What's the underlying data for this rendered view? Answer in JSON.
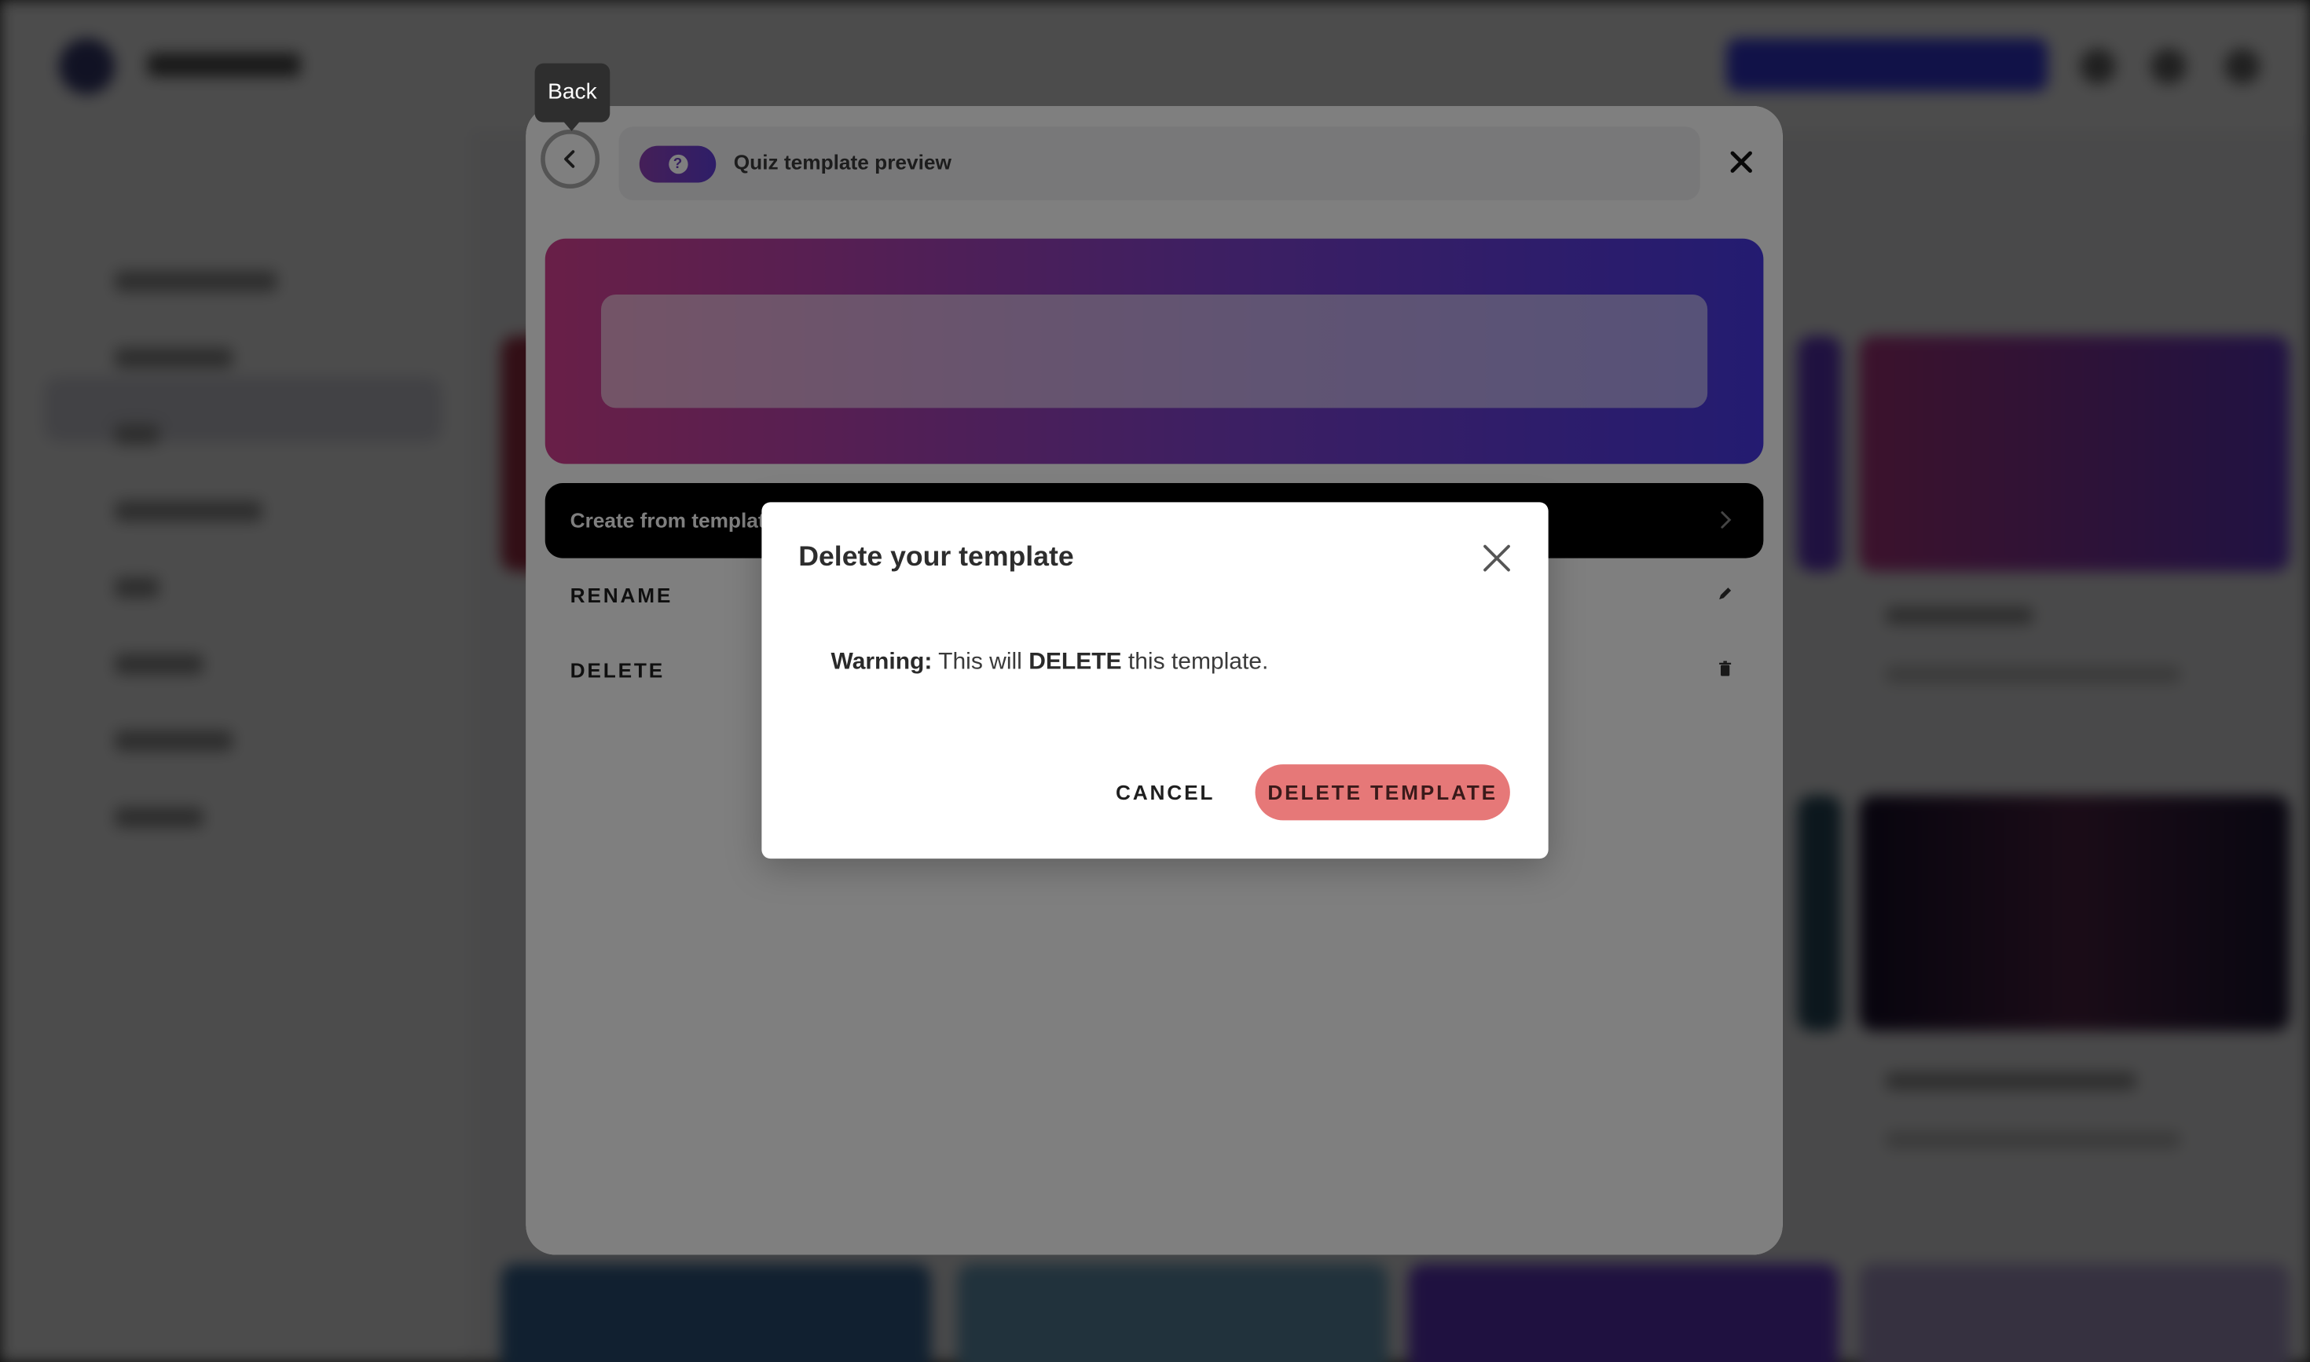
{
  "tooltip": {
    "text": "Back"
  },
  "preview": {
    "title": "Quiz template preview",
    "quiz_icon": "question-mark-icon",
    "create_label": "Create from template",
    "rename_label": "RENAME",
    "delete_label": "DELETE"
  },
  "dialog": {
    "title": "Delete your template",
    "warning_prefix": "Warning:",
    "warning_text_1": "This will",
    "warning_emphasis": "DELETE",
    "warning_text_2": "this template.",
    "cancel_label": "CANCEL",
    "confirm_label": "DELETE TEMPLATE"
  },
  "colors": {
    "confirm_button": "#e67878",
    "hero_gradient_start": "#d23f8f",
    "hero_gradient_end": "#4737e2",
    "create_button": "#000000"
  }
}
